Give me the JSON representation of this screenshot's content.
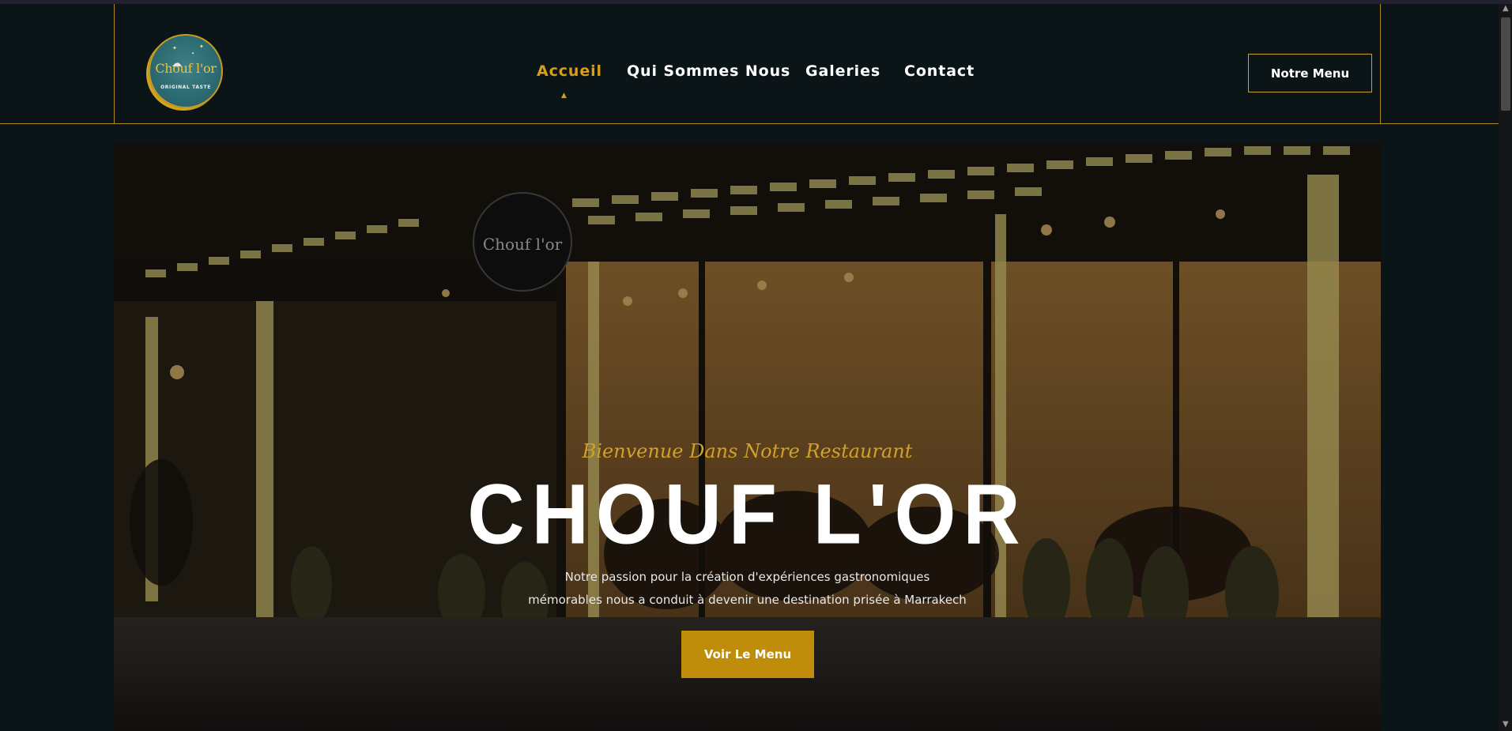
{
  "brand": {
    "logo_text": "Chouf l'or",
    "logo_tagline": "ORIGINAL TASTE"
  },
  "nav": {
    "items": [
      {
        "label": "Accueil",
        "active": true
      },
      {
        "label": "Qui Sommes Nous",
        "active": false
      },
      {
        "label": "Galeries",
        "active": false
      },
      {
        "label": "Contact",
        "active": false
      }
    ],
    "cta_label": "Notre Menu"
  },
  "hero": {
    "kicker": "Bienvenue Dans Notre Restaurant",
    "title": "CHOUF L'OR",
    "description_line1": "Notre passion pour la création d'expériences gastronomiques",
    "description_line2": "mémorables nous a conduit à devenir une destination prisée à Marrakech",
    "button_label": "Voir Le Menu",
    "photo_sign_text": "Chouf l'or"
  },
  "colors": {
    "background": "#0b1518",
    "accent": "#d89f16",
    "button": "#c08d0a",
    "frame": "#b08a1e"
  },
  "icons": {
    "nav_caret": "caret-up-icon",
    "scroll_up": "chevron-up-icon",
    "scroll_down": "chevron-down-icon"
  }
}
